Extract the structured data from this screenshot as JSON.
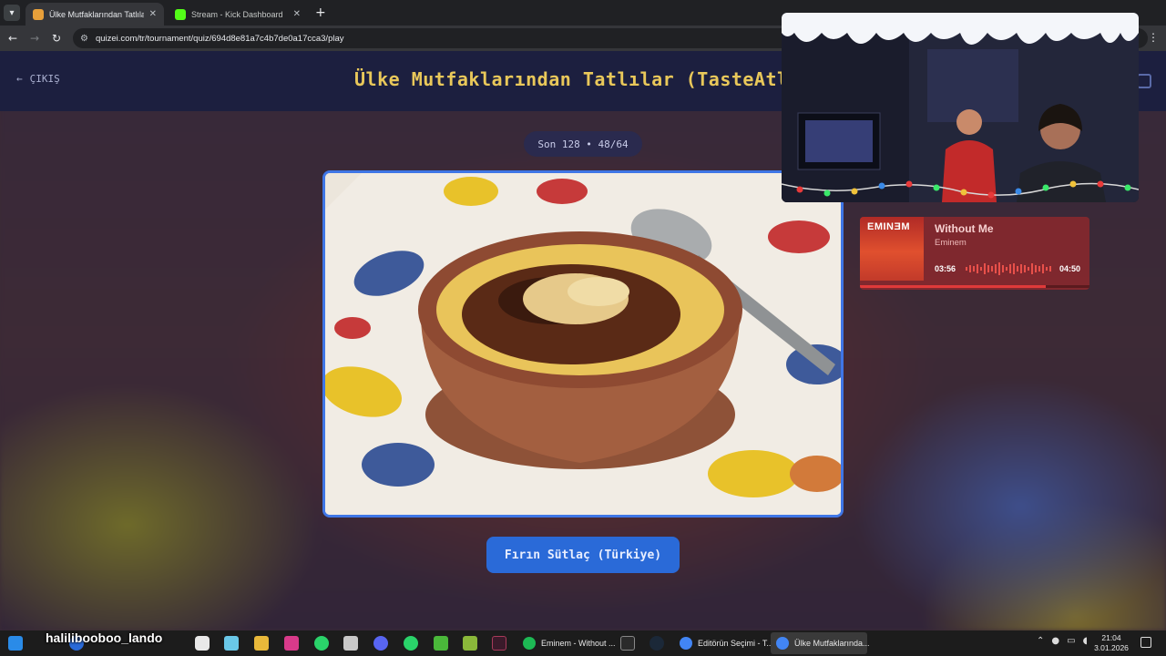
{
  "browser": {
    "tabs": [
      {
        "title": "Ülke Mutfaklarından Tatlılar (Tas",
        "active": true,
        "favicon_color": "#e8a03a"
      },
      {
        "title": "Stream - Kick Dashboard",
        "active": false,
        "favicon_color": "#53fc18"
      }
    ],
    "url": "quizei.com/tr/tournament/quiz/694d8e81a7c4b7de0a17cca3/play",
    "nav_icons": [
      "back-icon",
      "forward-icon",
      "reload-icon"
    ]
  },
  "page": {
    "back_label": "ÇIKIŞ",
    "title": "Ülke Mutfaklarından Tatlılar (TasteAtlas)",
    "round_label": "Son 128 • 48/64",
    "answer_label": "Fırın Sütlaç (Türkiye)",
    "accent": "#3f76e6",
    "title_color": "#e9c85a"
  },
  "music_widget": {
    "cover_text": "EMINƎM",
    "song": "Without Me",
    "artist": "Eminem",
    "elapsed": "03:56",
    "duration": "04:50",
    "progress": 0.81
  },
  "taskbar": {
    "overlay_name": "halilibooboo_lando",
    "apps": [
      {
        "label": "Streamlabs Desktop",
        "color": "#31c3a2"
      },
      {
        "label": "Eminem - Without ...",
        "color": "#1db954"
      },
      {
        "label": "Editörün Seçimi - T...",
        "color": "#4285f4"
      },
      {
        "label": "Ülke Mutfaklarında...",
        "color": "#4285f4"
      }
    ],
    "time": "21:04",
    "date": "3.01.2026"
  }
}
